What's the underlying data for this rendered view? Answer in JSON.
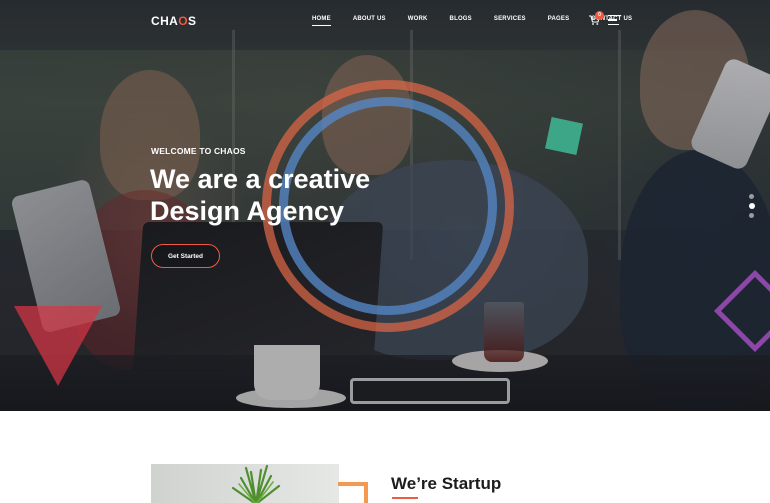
{
  "brand": {
    "logo_prefix": "CHA",
    "logo_accent": "O",
    "logo_suffix": "S",
    "accent_color": "#ef5a42"
  },
  "nav": {
    "items": [
      {
        "label": "HOME",
        "active": true
      },
      {
        "label": "ABOUT US",
        "active": false
      },
      {
        "label": "WORK",
        "active": false
      },
      {
        "label": "BLOGS",
        "active": false
      },
      {
        "label": "SERVICES",
        "active": false
      },
      {
        "label": "PAGES",
        "active": false
      },
      {
        "label": "CONTACT US",
        "active": false
      }
    ],
    "cart_count": "0",
    "cart_icon": "cart-icon",
    "menu_icon": "hamburger-menu-icon"
  },
  "hero": {
    "eyebrow": "WELCOME TO CHAOS",
    "title_line1": "We are a creative",
    "title_line2": "Design Agency",
    "cta_label": "Get Started",
    "slider_dots": 3,
    "active_dot": 2
  },
  "about": {
    "title": "We’re Startup"
  }
}
